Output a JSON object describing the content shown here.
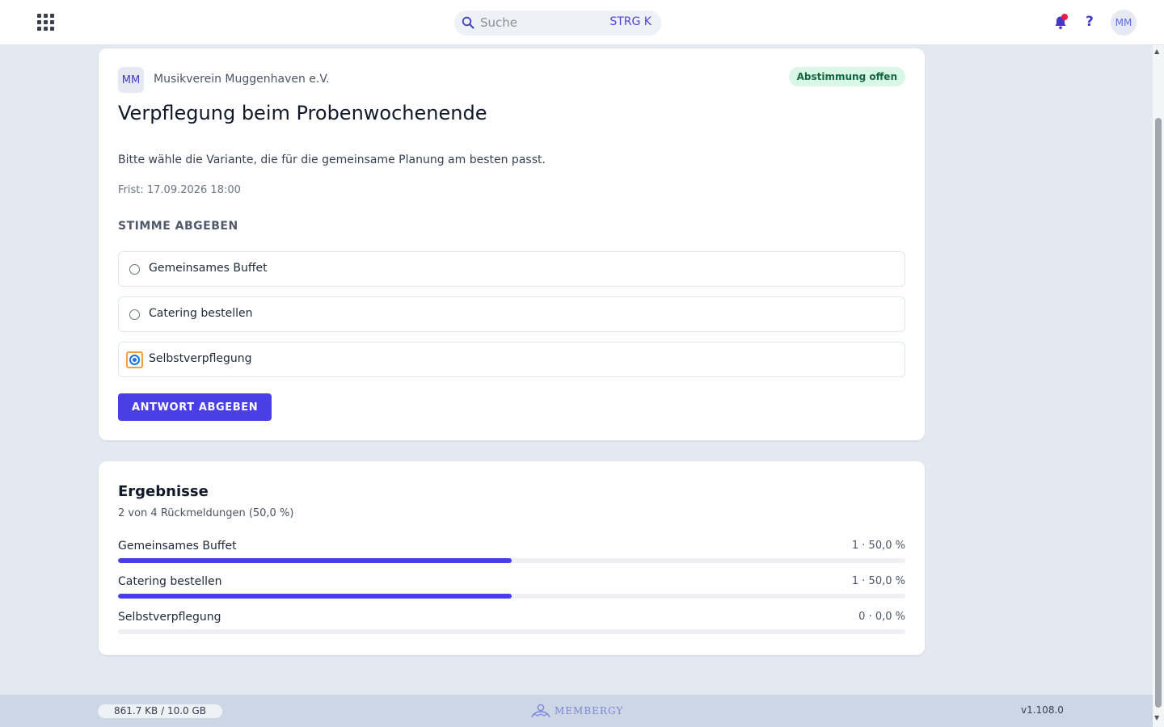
{
  "topbar": {
    "search_placeholder": "Suche",
    "search_shortcut": "STRG K",
    "user_initials": "MM",
    "help_label": "?"
  },
  "poll": {
    "org_initials": "MM",
    "org_name": "Musikverein Muggenhaven e.V.",
    "status": "Abstimmung offen",
    "title": "Verpflegung beim Probenwochenende",
    "description": "Bitte wähle die Variante, die für die gemeinsame Planung am besten passt.",
    "deadline": "Frist: 17.09.2026 18:00",
    "section_label": "STIMME ABGEBEN",
    "options": [
      {
        "label": "Gemeinsames Buffet",
        "selected": false
      },
      {
        "label": "Catering bestellen",
        "selected": false
      },
      {
        "label": "Selbstverpflegung",
        "selected": true
      }
    ],
    "submit_label": "ANTWORT ABGEBEN"
  },
  "results": {
    "title": "Ergebnisse",
    "summary": "2 von 4 Rückmeldungen (50,0 %)",
    "rows": [
      {
        "label": "Gemeinsames Buffet",
        "value": "1 · 50,0 %",
        "percent": 50
      },
      {
        "label": "Catering bestellen",
        "value": "1 · 50,0 %",
        "percent": 50
      },
      {
        "label": "Selbstverpflegung",
        "value": "0 · 0,0 %",
        "percent": 0
      }
    ]
  },
  "footer": {
    "storage": "861.7 KB / 10.0 GB",
    "brand": "MEMBERGY",
    "version": "v1.108.0"
  },
  "colors": {
    "accent": "#4a3ee6",
    "status_bg": "#d9f7e6",
    "status_text": "#15673f",
    "background": "#e3e8f1"
  },
  "icons": {
    "apps": "grid-icon",
    "search": "magnifier-icon",
    "notifications": "bell-icon",
    "help": "question-icon"
  }
}
